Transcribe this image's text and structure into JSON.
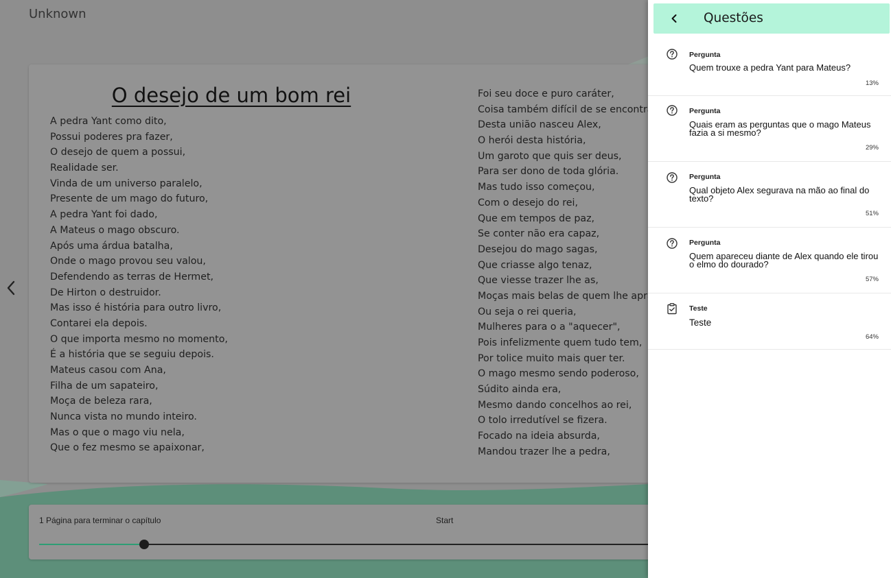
{
  "reader": {
    "author": "Unknown",
    "chapter_title": "O desejo de um bom rei",
    "left_column": [
      "A pedra Yant como dito,",
      "Possui poderes pra fazer,",
      "O desejo de quem a possui,",
      "Realidade ser.",
      "Vinda de um universo paralelo,",
      "Presente de um mago do futuro,",
      "A pedra Yant foi dado,",
      "A Mateus o mago obscuro.",
      "Após uma árdua batalha,",
      "Onde o mago provou seu valou,",
      "Defendendo as terras de Hermet,",
      "De Hirton o destruidor.",
      "Mas isso é história para outro livro,",
      "Contarei ela depois.",
      "O que importa mesmo no momento,",
      "É a história que se seguiu depois.",
      "Mateus casou com Ana,",
      "Filha de um sapateiro,",
      "Moça de beleza rara,",
      "Nunca vista no mundo inteiro.",
      "Mas o que o mago viu nela,",
      "Que o fez mesmo se apaixonar,"
    ],
    "right_column": [
      "Foi seu doce e puro caráter,",
      "Coisa também difícil de se encontra",
      "Desta união nasceu Alex,",
      "O herói desta história,",
      "Um garoto que quis ser deus,",
      "Para ser dono de toda glória.",
      "Mas tudo isso começou,",
      "Com o desejo do rei,",
      "Que em tempos de paz,",
      "Se conter não era capaz,",
      "Desejou do mago sagas,",
      "Que criasse algo tenaz,",
      "Que viesse trazer lhe as,",
      "Moças mais belas de quem lhe apra",
      "Ou seja o rei queria,",
      "Mulheres para o a \"aquecer\",",
      "Pois infelizmente quem tudo tem,",
      "Por tolice muito mais quer ter.",
      "O mago mesmo sendo poderoso,",
      "Súdito ainda era,",
      "Mesmo dando concelhos ao rei,",
      "O tolo irredutível se fizera.",
      "Focado na ideia absurda,",
      "Mandou trazer lhe a pedra,"
    ],
    "progress": {
      "label": "1 Página para terminar o capítulo",
      "start_label": "Start",
      "fraction": 0.155
    }
  },
  "drawer": {
    "title": "Questões",
    "items": [
      {
        "icon": "help-circle-icon",
        "type": "Pergunta",
        "text": "Quem trouxe a pedra Yant para Mateus?",
        "percent": "13%"
      },
      {
        "icon": "help-circle-icon",
        "type": "Pergunta",
        "text": "Quais eram as perguntas que o mago Mateus fazia a si mesmo?",
        "percent": "29%"
      },
      {
        "icon": "help-circle-icon",
        "type": "Pergunta",
        "text": "Qual objeto Alex segurava na mão ao final do texto?",
        "percent": "51%"
      },
      {
        "icon": "help-circle-icon",
        "type": "Pergunta",
        "text": "Quem apareceu diante de Alex quando ele tirou o elmo do dourado?",
        "percent": "57%"
      },
      {
        "icon": "clipboard-check-icon",
        "type": "Teste",
        "text": "Teste",
        "percent": "64%"
      }
    ]
  },
  "colors": {
    "accent": "#b4f4da",
    "slider_fill": "#2e9e74",
    "overlay_bg": "#8e8e8e"
  }
}
